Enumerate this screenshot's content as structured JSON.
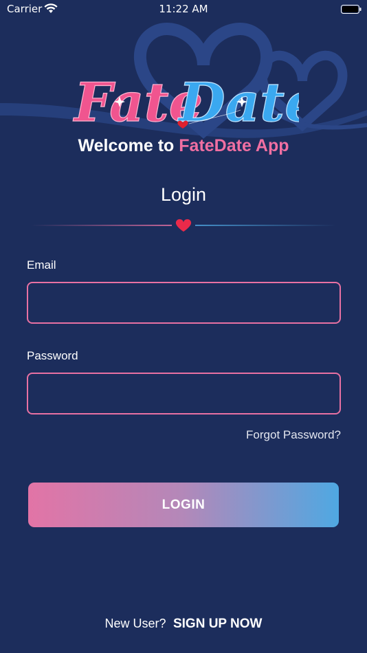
{
  "status_bar": {
    "carrier": "Carrier",
    "time": "11:22 AM"
  },
  "logo": {
    "word1": "Fate",
    "word2": "Date",
    "colors": {
      "pink": "#f0558f",
      "blue": "#3aa8f0"
    }
  },
  "header": {
    "welcome_prefix": "Welcome to",
    "app_name": "FateDate App"
  },
  "form": {
    "title": "Login",
    "email_label": "Email",
    "email_value": "",
    "password_label": "Password",
    "password_value": "",
    "forgot_password": "Forgot Password?",
    "login_button": "LOGIN"
  },
  "footer": {
    "new_user": "New User?",
    "signup": "SIGN UP NOW"
  },
  "theme": {
    "background": "#1c2d5c",
    "accent_pink": "#f06fa2",
    "accent_blue": "#4fa8e2",
    "input_border": "#e971a3"
  }
}
